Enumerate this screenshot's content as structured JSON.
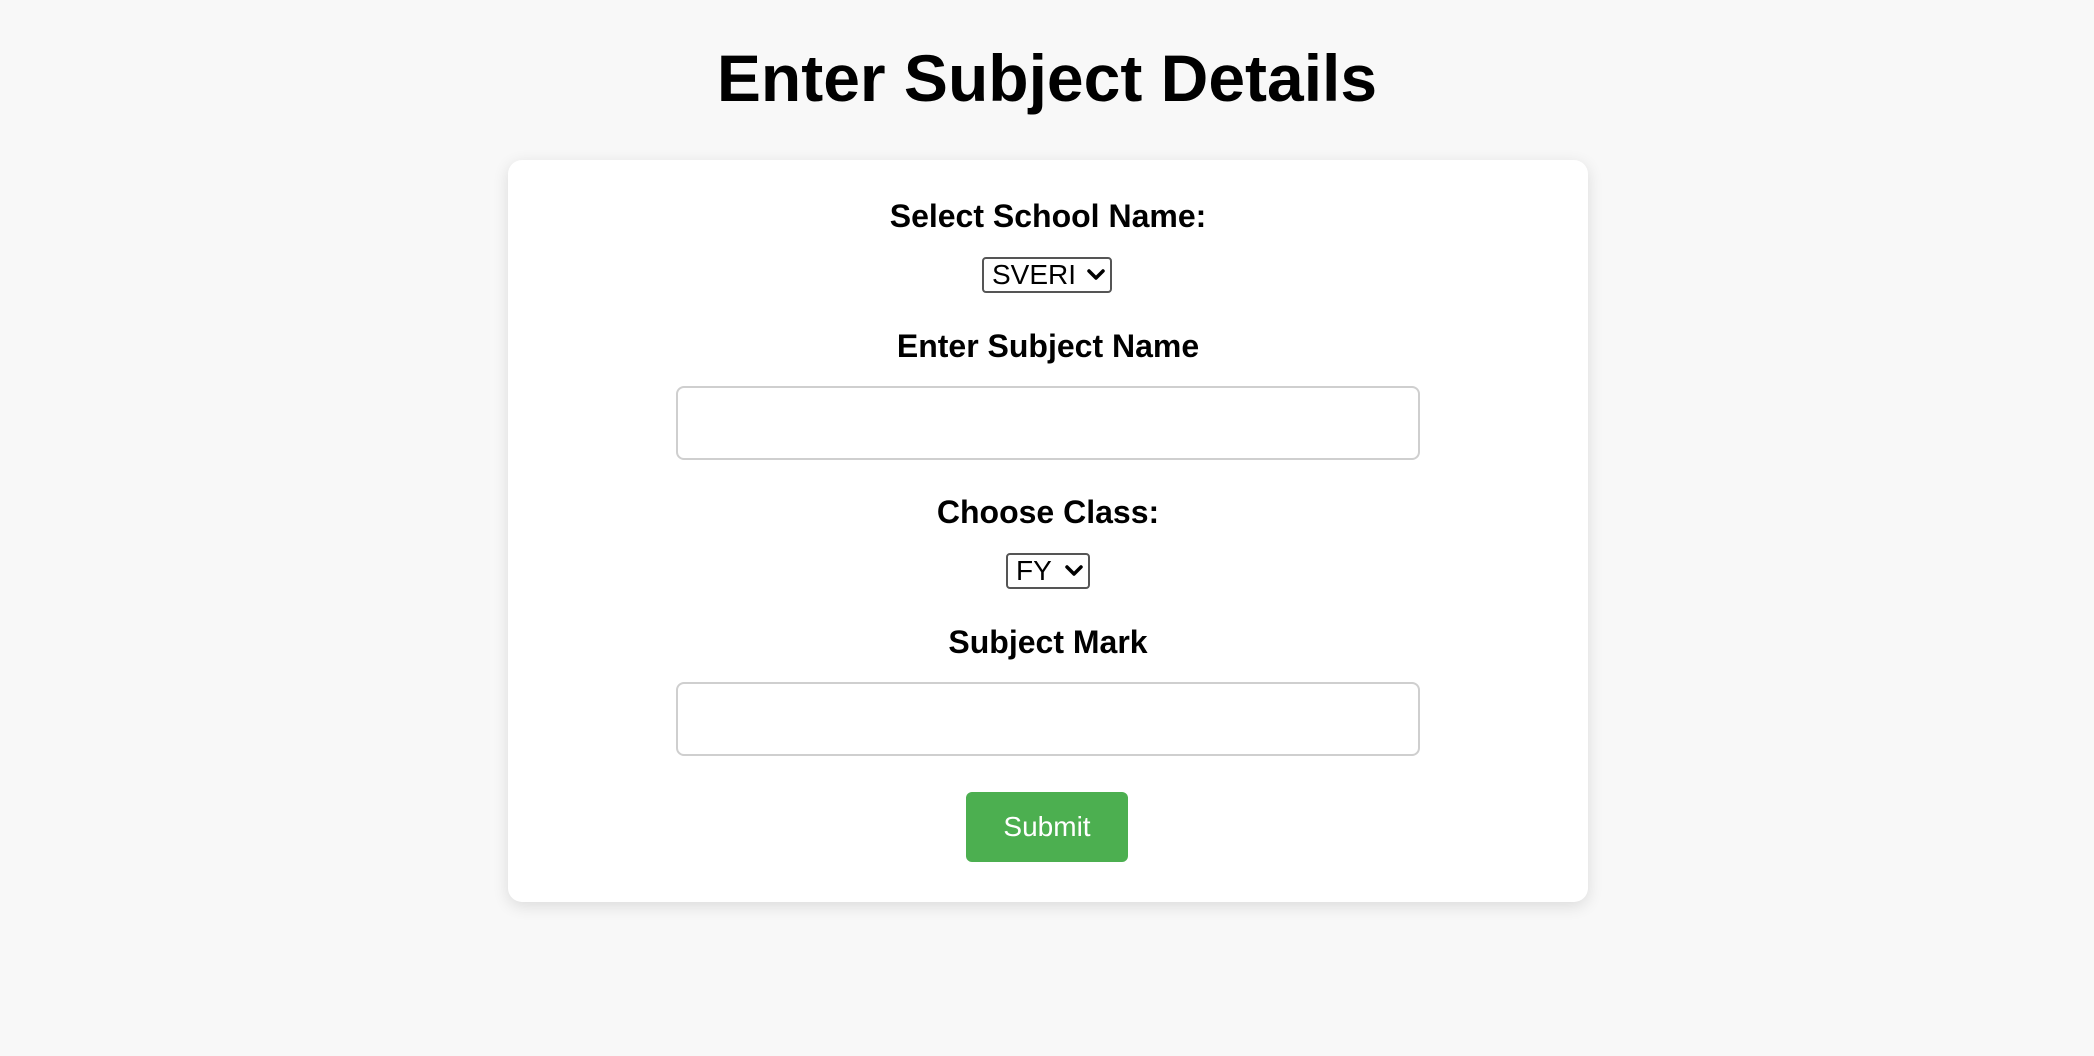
{
  "page": {
    "title": "Enter Subject Details"
  },
  "form": {
    "school_label": "Select School Name:",
    "school_selected": "SVERI",
    "subject_label": "Enter Subject Name",
    "subject_value": "",
    "class_label": "Choose Class:",
    "class_selected": "FY",
    "mark_label": "Subject Mark",
    "mark_value": "",
    "submit_label": "Submit"
  },
  "icons": {
    "dropdown": "chevron-down-icon"
  },
  "colors": {
    "background": "#f8f8f8",
    "card": "#ffffff",
    "submit": "#4caf50",
    "submit_text": "#ffffff"
  }
}
